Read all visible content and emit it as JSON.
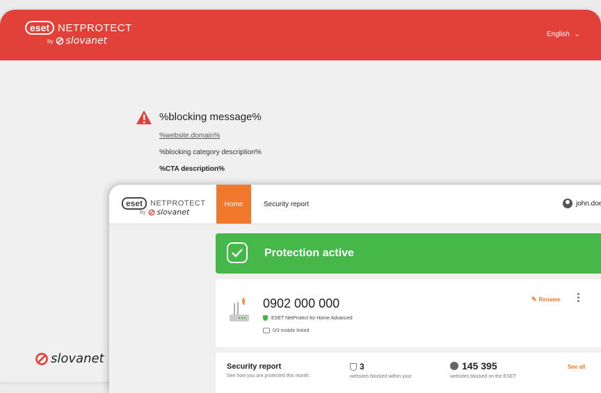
{
  "back_window": {
    "logo": {
      "eset": "eset",
      "product": "NETPROTECT",
      "by": "by",
      "partner": "slovanet"
    },
    "language": "English",
    "blocking": {
      "title": "%blocking message%",
      "domain": "%website.domain%",
      "category": "%blocking category description%",
      "cta": "%CTA description%"
    },
    "footer_logo": "slovanet"
  },
  "front_window": {
    "logo": {
      "eset": "eset",
      "product": "NETPROTECT",
      "by": "by",
      "partner": "slovanet"
    },
    "nav": {
      "home": "Home",
      "security_report": "Security report"
    },
    "user": "john.doe@",
    "protection": "Protection active",
    "device": {
      "number": "0902 000 000",
      "plan": "ESET NetProtect for Home Advanced",
      "mobile": "0/3 mobile linked",
      "rename": "Rename"
    },
    "report": {
      "title": "Security report",
      "subtitle": "See how you are protected this month:",
      "stat1_value": "3",
      "stat1_label": "websites blocked within your",
      "stat2_value": "145 395",
      "stat2_label": "websites blocked on the ESET",
      "see_all": "See all"
    }
  },
  "colors": {
    "brand_red": "#e2413a",
    "orange": "#f0782c",
    "green": "#45b849"
  }
}
